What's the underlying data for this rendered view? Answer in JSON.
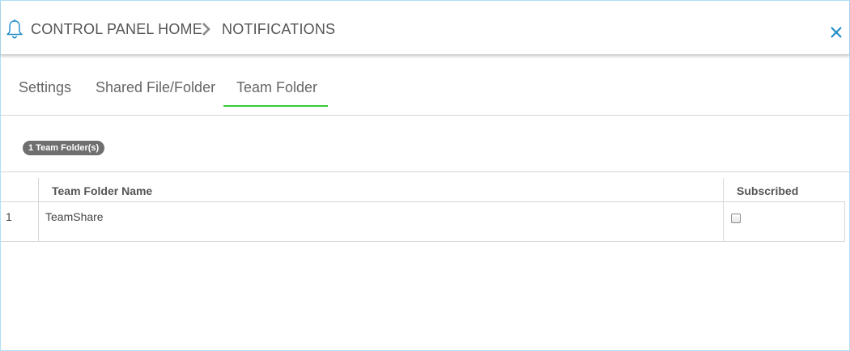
{
  "header": {
    "breadcrumb_home": "CONTROL PANEL HOME",
    "breadcrumb_current": "NOTIFICATIONS",
    "bell_icon": "bell-icon",
    "separator_icon": "chevron-right-icon",
    "close_icon": "close-icon",
    "accent_color": "#1b8ac9"
  },
  "tabs": [
    {
      "label": "Settings",
      "active": false
    },
    {
      "label": "Shared File/Folder",
      "active": false
    },
    {
      "label": "Team Folder",
      "active": true
    }
  ],
  "tab_active_color": "#33cc33",
  "summary": {
    "count_badge": "1 Team Folder(s)"
  },
  "table": {
    "columns": [
      "Team Folder Name",
      "Subscribed"
    ],
    "rows": [
      {
        "index": "1",
        "name": "TeamShare",
        "subscribed": false
      }
    ]
  }
}
